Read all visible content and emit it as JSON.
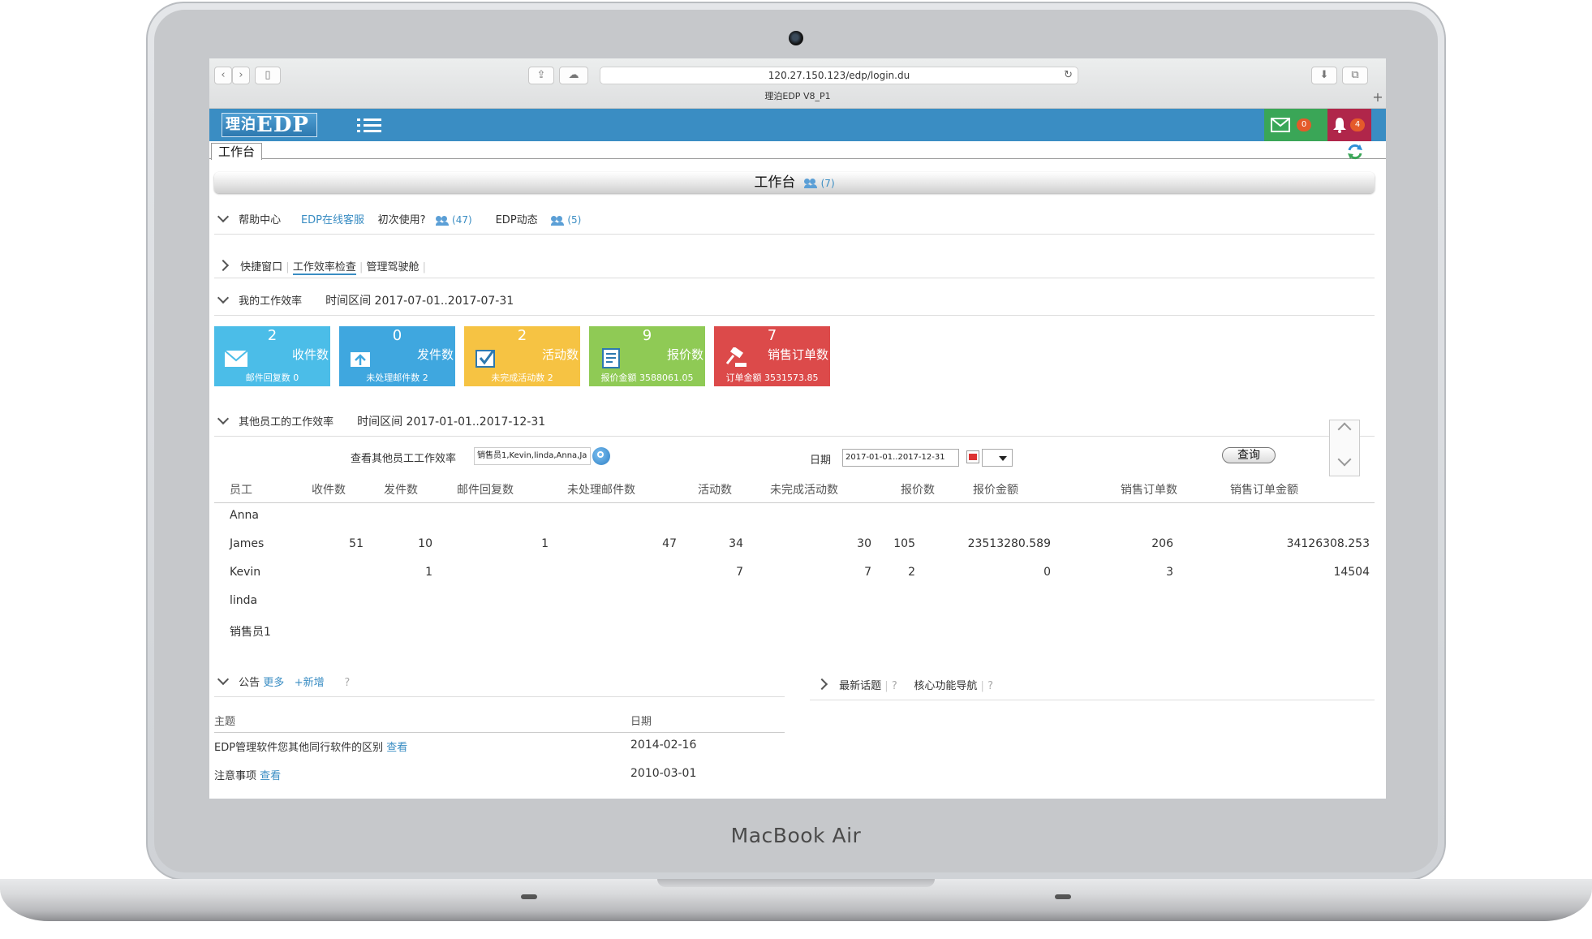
{
  "device": {
    "brand": "MacBook Air"
  },
  "browser": {
    "url": "120.27.150.123/edp/login.du",
    "tab_title": "理泊EDP V8_P1",
    "new_tab": "+"
  },
  "app": {
    "logo_cn": "理泊",
    "logo_en": "EDP",
    "mail_count": "0",
    "bell_count": "4",
    "accent_color": "#3a8dc3"
  },
  "tabs": {
    "workbench": "工作台"
  },
  "page": {
    "title": "工作台",
    "title_count": "(7)"
  },
  "help": {
    "label": "帮助中心",
    "online_service": "EDP在线客服",
    "first_use": "初次使用?",
    "first_use_count": "(47)",
    "edp_news": "EDP动态",
    "edp_news_count": "(5)"
  },
  "quick_tabs": [
    "快捷窗口",
    "工作效率检查",
    "管理驾驶舱"
  ],
  "my_efficiency": {
    "label": "我的工作效率",
    "range": "时间区间 2017-07-01..2017-07-31"
  },
  "cards": [
    {
      "num": "2",
      "label": "收件数",
      "sub": "邮件回复数 0",
      "color": "#4bbde8"
    },
    {
      "num": "0",
      "label": "发件数",
      "sub": "未处理邮件数 2",
      "color": "#3fa7df"
    },
    {
      "num": "2",
      "label": "活动数",
      "sub": "未完成活动数 2",
      "color": "#f6c343"
    },
    {
      "num": "9",
      "label": "报价数",
      "sub": "报价金额 3588061.05",
      "color": "#8fca55"
    },
    {
      "num": "7",
      "label": "销售订单数",
      "sub": "订单金额 3531573.85",
      "color": "#dc4a4a"
    }
  ],
  "other_efficiency": {
    "label": "其他员工的工作效率",
    "range": "时间区间 2017-01-01..2017-12-31",
    "staff_label": "查看其他员工工作效率",
    "staff_value": "销售员1,Kevin,linda,Anna,Ja",
    "date_label": "日期",
    "date_value": "2017-01-01..2017-12-31",
    "query": "查询"
  },
  "table": {
    "headers": [
      "员工",
      "收件数",
      "发件数",
      "邮件回复数",
      "未处理邮件数",
      "活动数",
      "未完成活动数",
      "报价数",
      "报价金额",
      "销售订单数",
      "销售订单金额"
    ],
    "rows": [
      {
        "name": "Anna",
        "cells": [
          "",
          "",
          "",
          "",
          "",
          "",
          "",
          "",
          "",
          ""
        ]
      },
      {
        "name": "James",
        "cells": [
          "51",
          "10",
          "1",
          "47",
          "34",
          "30",
          "105",
          "23513280.589",
          "206",
          "34126308.253"
        ]
      },
      {
        "name": "Kevin",
        "cells": [
          "",
          "1",
          "",
          "",
          "7",
          "7",
          "2",
          "0",
          "3",
          "14504"
        ]
      },
      {
        "name": "linda",
        "cells": [
          "",
          "",
          "",
          "",
          "",
          "",
          "",
          "",
          "",
          ""
        ]
      },
      {
        "name": "销售员1",
        "cells": [
          "",
          "",
          "",
          "",
          "",
          "",
          "",
          "",
          "",
          ""
        ]
      }
    ]
  },
  "notices": {
    "label": "公告",
    "more": "更多",
    "add": "+新增",
    "help": "?",
    "col_subject": "主题",
    "col_date": "日期",
    "items": [
      {
        "subject": "EDP管理软件您其他同行软件的区别",
        "view": "查看",
        "date": "2014-02-16"
      },
      {
        "subject": "注意事项",
        "view": "查看",
        "date": "2010-03-01"
      }
    ]
  },
  "topics": {
    "latest": "最新话题",
    "core_nav": "核心功能导航",
    "help": "?"
  }
}
